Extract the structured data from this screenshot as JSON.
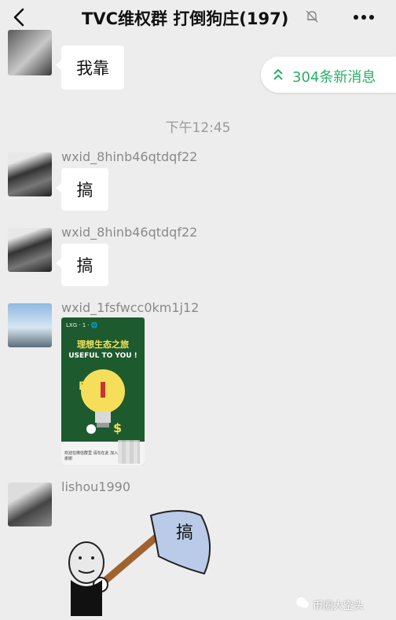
{
  "header": {
    "title": "TVC维权群 打倒狗庄(197)",
    "back_icon": "chevron-left-icon",
    "mute_icon": "mute-bell-icon",
    "more_icon": "more-dots-icon"
  },
  "new_messages": {
    "label": "304条新消息",
    "icon": "double-chevron-up-icon"
  },
  "timestamp": "下午12:45",
  "messages": [
    {
      "sender": "",
      "text": "我靠"
    },
    {
      "sender": "wxid_8hinb46qtdqf22",
      "text": "搞"
    },
    {
      "sender": "wxid_8hinb46qtdqf22",
      "text": "搞"
    },
    {
      "sender": "wxid_1fsfwcc0km1j12",
      "type": "image",
      "poster": {
        "logo": "LXG · 1 · 🌐",
        "title": "理想生态之旅",
        "subtitle": "USEFUL TO YOU !",
        "footer": "欢迎在微信群里 请勿在此 加入 谢谢"
      }
    },
    {
      "sender": "lishou1990",
      "type": "sticker",
      "sticker_text": "搞"
    }
  ],
  "watermark": {
    "text": "币圈大空头",
    "icon": "wechat-channel-icon"
  },
  "colors": {
    "accent": "#2aae67",
    "background": "#ededed",
    "bubble": "#ffffff",
    "poster_green": "#1d5a2e"
  }
}
